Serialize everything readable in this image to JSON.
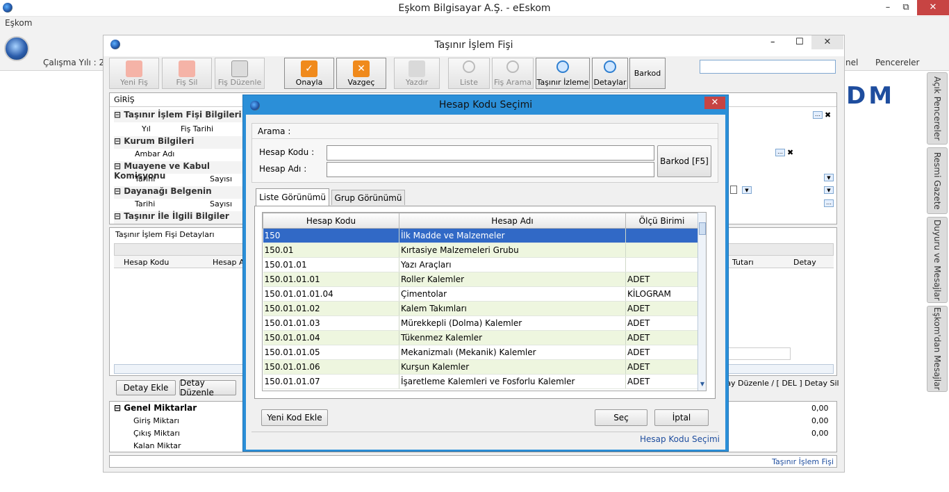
{
  "app": {
    "title": "Eşkom Bilgisayar A.Ş. - eEskom",
    "menu_eskom": "Eşkom",
    "calisma_yili": "Çalışma Yılı : 20",
    "menu_panel": "nel",
    "menu_pencereler": "Pencereler",
    "logo_text": "DM"
  },
  "side_tabs": [
    "Açık Pencereler",
    "Resmi Gazete",
    "Duyuru ve Mesajlar",
    "Eşkom'dan Mesajlar"
  ],
  "window": {
    "title": "Taşınır İşlem Fişi",
    "status": "Taşınır İşlem Fişi"
  },
  "toolbar": [
    "Yeni Fiş",
    "Fiş Sil",
    "Fiş Düzenle",
    "Onayla",
    "Vazgeç",
    "Yazdır",
    "Liste",
    "Fiş Arama",
    "Taşınır İzleme",
    "Detaylar",
    "Barkod"
  ],
  "form": {
    "header": "GİRİŞ",
    "sections": {
      "s1": "Taşınır İşlem Fişi Bilgileri",
      "s2": "Kurum Bilgileri",
      "s3": "Muayene ve Kabul Komisyonu",
      "s4": "Dayanağı Belgenin",
      "s5": "Taşınır İle İlgili Bilgiler"
    },
    "fields": {
      "yil": "Yıl",
      "fis_tarihi": "Fiş Tarihi",
      "ambar_adi": "Ambar Adı",
      "tarihi": "Tarihi",
      "sayisi": "Sayısı",
      "tarihi2": "Tarihi",
      "sayisi2": "Sayısı"
    }
  },
  "details": {
    "title": "Taşınır İşlem Fişi Detayları",
    "col_hesap_kodu": "Hesap Kodu",
    "col_hesap_adi": "Hesap Ad",
    "col_tutari": "Tutarı",
    "col_detay": "Detay",
    "btn_detay_ekle": "Detay Ekle",
    "btn_detay_duzenle": "Detay Düzenle",
    "hint": "tay Düzenle / [ DEL ] Detay Sil"
  },
  "genel": {
    "title": "Genel Miktarlar",
    "giris": "Giriş Miktarı",
    "cikis": "Çıkış Miktarı",
    "kalan": "Kalan Miktar",
    "giris_val": "0,00",
    "cikis_val": "0,00",
    "kalan_val": "0,00"
  },
  "dialog": {
    "title": "Hesap Kodu Seçimi",
    "arama": "Arama :",
    "hesap_kodu_label": "Hesap Kodu  :",
    "hesap_adi_label": "Hesap Adı    :",
    "barkod_btn": "Barkod [F5]",
    "tab_liste": "Liste Görünümü",
    "tab_grup": "Grup Görünümü",
    "columns": [
      "Hesap Kodu",
      "Hesap Adı",
      "Ölçü Birimi"
    ],
    "rows": [
      [
        "150",
        "İlk Madde ve Malzemeler",
        ""
      ],
      [
        "150.01",
        "Kırtasiye Malzemeleri Grubu",
        ""
      ],
      [
        "150.01.01",
        "Yazı Araçları",
        ""
      ],
      [
        "150.01.01.01",
        "Roller Kalemler",
        "ADET"
      ],
      [
        "150.01.01.01.04",
        "Çimentolar",
        "KİLOGRAM"
      ],
      [
        "150.01.01.02",
        "Kalem Takımları",
        "ADET"
      ],
      [
        "150.01.01.03",
        "Mürekkepli (Dolma) Kalemler",
        "ADET"
      ],
      [
        "150.01.01.04",
        "Tükenmez Kalemler",
        "ADET"
      ],
      [
        "150.01.01.05",
        "Mekanizmalı (Mekanik) Kalemler",
        "ADET"
      ],
      [
        "150.01.01.06",
        "Kurşun Kalemler",
        "ADET"
      ],
      [
        "150.01.01.07",
        "İşaretleme Kalemleri ve Fosforlu Kalemler",
        "ADET"
      ]
    ],
    "btn_yeni": "Yeni Kod Ekle",
    "btn_sec": "Seç",
    "btn_iptal": "İptal",
    "footer": "Hesap Kodu Seçimi"
  }
}
